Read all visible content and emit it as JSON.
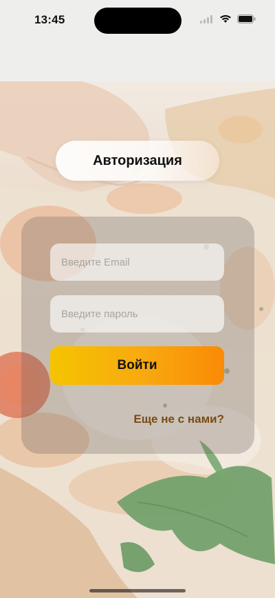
{
  "status_bar": {
    "time": "13:45",
    "icons": [
      "signal-icon",
      "wifi-icon",
      "battery-icon"
    ]
  },
  "header": {
    "title": "Авторизация"
  },
  "form": {
    "email_placeholder": "Введите Email",
    "email_value": "",
    "password_placeholder": "Введите пароль",
    "password_value": "",
    "login_label": "Войти",
    "signup_link": "Еще не с нами?"
  },
  "colors": {
    "button_gradient_start": "#f5c400",
    "button_gradient_end": "#fb8a05",
    "link_color": "#7a4a14"
  }
}
